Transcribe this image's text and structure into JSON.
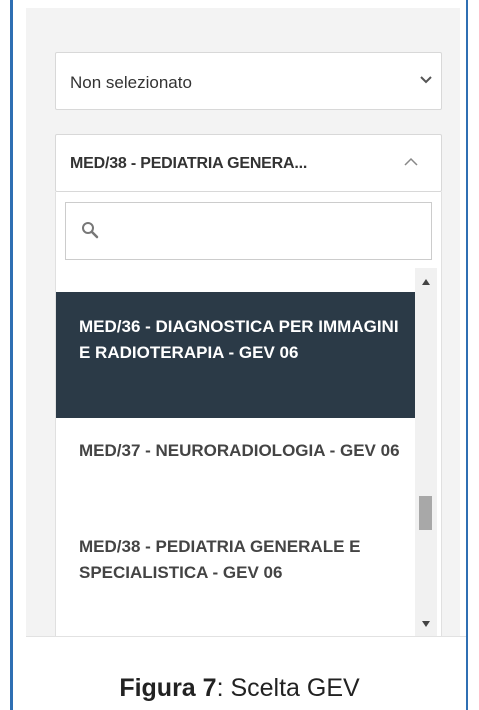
{
  "filter_select": {
    "value": "Non selezionato",
    "icon": "chevron-down-icon"
  },
  "ssd_select": {
    "value": "MED/38 - PEDIATRIA GENERA...",
    "icon": "chevron-up-icon"
  },
  "search": {
    "placeholder": "",
    "icon": "search-icon"
  },
  "options": [
    {
      "label": "MED/36 - DIAGNOSTICA PER IMMAGINI E RADIOTERAPIA - GEV 06",
      "selected": true
    },
    {
      "label": "MED/37 - NEURORADIOLOGIA - GEV 06",
      "selected": false
    },
    {
      "label": "MED/38 - PEDIATRIA GENERALE E SPECIALISTICA - GEV 06",
      "selected": false
    }
  ],
  "scrollbar": {
    "position": 0.72
  },
  "caption": {
    "prefix": "Figura 7",
    "rest": ": Scelta GEV"
  },
  "colors": {
    "selected_bg": "#2b3a47",
    "frame": "#2f6fb3"
  }
}
